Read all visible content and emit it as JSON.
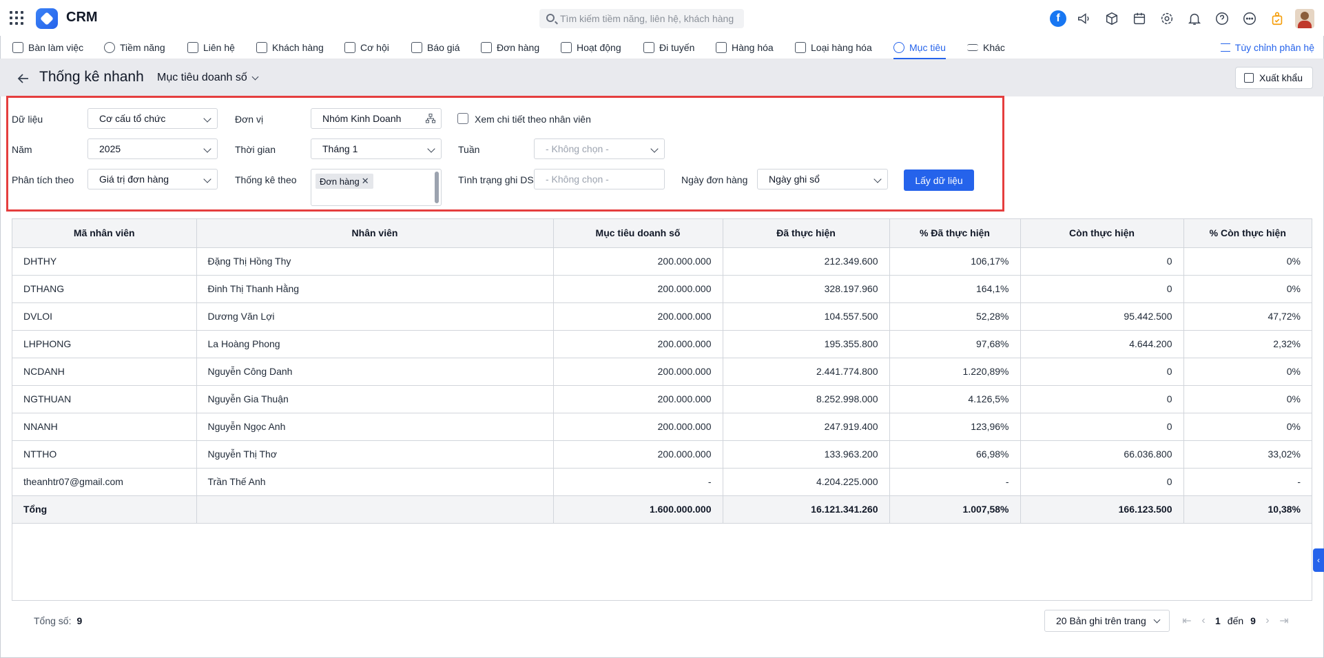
{
  "app": {
    "title": "CRM"
  },
  "search": {
    "placeholder": "Tìm kiếm tiềm năng, liên hệ, khách hàng"
  },
  "topbar_icons": [
    "grid-menu-icon",
    "facebook-icon",
    "megaphone-icon",
    "box-icon",
    "calendar-icon",
    "gear-icon",
    "bell-icon",
    "help-icon",
    "more-icon",
    "badge-icon",
    "user-avatar"
  ],
  "nav": {
    "items": [
      {
        "label": "Bàn làm việc",
        "icon": "home-icon"
      },
      {
        "label": "Tiềm năng",
        "icon": "user-circle-icon"
      },
      {
        "label": "Liên hệ",
        "icon": "contact-icon"
      },
      {
        "label": "Khách hàng",
        "icon": "building-icon"
      },
      {
        "label": "Cơ hội",
        "icon": "wallet-icon"
      },
      {
        "label": "Báo giá",
        "icon": "quote-icon"
      },
      {
        "label": "Đơn hàng",
        "icon": "cart-icon"
      },
      {
        "label": "Hoạt động",
        "icon": "activity-icon"
      },
      {
        "label": "Đi tuyến",
        "icon": "route-icon"
      },
      {
        "label": "Hàng hóa",
        "icon": "cube-icon"
      },
      {
        "label": "Loại hàng hóa",
        "icon": "category-icon"
      },
      {
        "label": "Mục tiêu",
        "icon": "target-icon",
        "active": true
      },
      {
        "label": "Khác",
        "icon": "menu-icon"
      }
    ],
    "customize_label": "Tùy chỉnh phân hệ"
  },
  "header": {
    "title": "Thống kê nhanh",
    "report_select": "Mục tiêu doanh số",
    "export_label": "Xuất khẩu"
  },
  "filters": {
    "data_label": "Dữ liệu",
    "data_value": "Cơ cấu tổ chức",
    "unit_label": "Đơn vị",
    "unit_value": "Nhóm Kinh Doanh",
    "detail_label": "Xem chi tiết theo nhân viên",
    "year_label": "Năm",
    "year_value": "2025",
    "time_label": "Thời gian",
    "time_value": "Tháng 1",
    "week_label": "Tuần",
    "week_value": "- Không chọn -",
    "analyze_label": "Phân tích theo",
    "analyze_value": "Giá trị đơn hàng",
    "stat_label": "Thống kê theo",
    "stat_tag": "Đơn hàng",
    "status_label": "Tình trạng ghi DS",
    "status_value": "- Không chọn -",
    "date_label": "Ngày đơn hàng",
    "date_value": "Ngày ghi sổ",
    "get_data_label": "Lấy dữ liệu"
  },
  "table": {
    "columns": [
      "Mã nhân viên",
      "Nhân viên",
      "Mục tiêu doanh số",
      "Đã thực hiện",
      "% Đã thực hiện",
      "Còn thực hiện",
      "% Còn thực hiện"
    ],
    "rows": [
      [
        "DHTHY",
        "Đặng Thị Hồng Thy",
        "200.000.000",
        "212.349.600",
        "106,17%",
        "0",
        "0%"
      ],
      [
        "DTHANG",
        "Đinh Thị Thanh Hằng",
        "200.000.000",
        "328.197.960",
        "164,1%",
        "0",
        "0%"
      ],
      [
        "DVLOI",
        "Dương Văn Lợi",
        "200.000.000",
        "104.557.500",
        "52,28%",
        "95.442.500",
        "47,72%"
      ],
      [
        "LHPHONG",
        "La Hoàng Phong",
        "200.000.000",
        "195.355.800",
        "97,68%",
        "4.644.200",
        "2,32%"
      ],
      [
        "NCDANH",
        "Nguyễn Công Danh",
        "200.000.000",
        "2.441.774.800",
        "1.220,89%",
        "0",
        "0%"
      ],
      [
        "NGTHUAN",
        "Nguyễn Gia Thuận",
        "200.000.000",
        "8.252.998.000",
        "4.126,5%",
        "0",
        "0%"
      ],
      [
        "NNANH",
        "Nguyễn Ngọc Anh",
        "200.000.000",
        "247.919.400",
        "123,96%",
        "0",
        "0%"
      ],
      [
        "NTTHO",
        "Nguyễn Thị Thơ",
        "200.000.000",
        "133.963.200",
        "66,98%",
        "66.036.800",
        "33,02%"
      ],
      [
        "theanhtr07@gmail.com",
        "Trần Thế Anh",
        "-",
        "4.204.225.000",
        "-",
        "0",
        "-"
      ]
    ],
    "total": [
      "Tổng",
      "",
      "1.600.000.000",
      "16.121.341.260",
      "1.007,58%",
      "166.123.500",
      "10,38%"
    ]
  },
  "footer": {
    "total_label": "Tổng số:",
    "total_value": "9",
    "page_size": "20 Bản ghi trên trang",
    "page_from": "1",
    "page_to_label": "đến",
    "page_to": "9"
  }
}
